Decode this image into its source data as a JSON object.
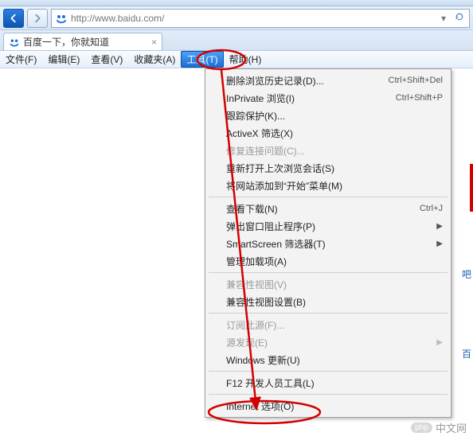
{
  "address": {
    "url": "http://www.baidu.com/"
  },
  "tab": {
    "title": "百度一下，你就知道"
  },
  "menubar": {
    "file": "文件(F)",
    "edit": "编辑(E)",
    "view": "查看(V)",
    "fav": "收藏夹(A)",
    "tools": "工具(T)",
    "help": "帮助(H)"
  },
  "dropdown": {
    "delete_history": "删除浏览历史记录(D)...",
    "delete_history_accel": "Ctrl+Shift+Del",
    "inprivate": "InPrivate 浏览(I)",
    "inprivate_accel": "Ctrl+Shift+P",
    "tracking": "跟踪保护(K)...",
    "activex": "ActiveX 筛选(X)",
    "fix_conn": "修复连接问题(C)...",
    "reopen": "重新打开上次浏览会话(S)",
    "add_start": "将网站添加到“开始”菜单(M)",
    "downloads": "查看下载(N)",
    "downloads_accel": "Ctrl+J",
    "popup": "弹出窗口阻止程序(P)",
    "smartscreen": "SmartScreen 筛选器(T)",
    "addons": "管理加载项(A)",
    "compat_view": "兼容性视图(V)",
    "compat_settings": "兼容性视图设置(B)",
    "subscribe": "订阅此源(F)...",
    "feed_discover": "源发现(E)",
    "win_update": "Windows 更新(U)",
    "f12": "F12 开发人员工具(L)",
    "internet_options": "Internet 选项(O)"
  },
  "edge": {
    "t1": "吧",
    "t2": "百"
  },
  "watermark": {
    "badge": "php",
    "text": "中文网"
  }
}
